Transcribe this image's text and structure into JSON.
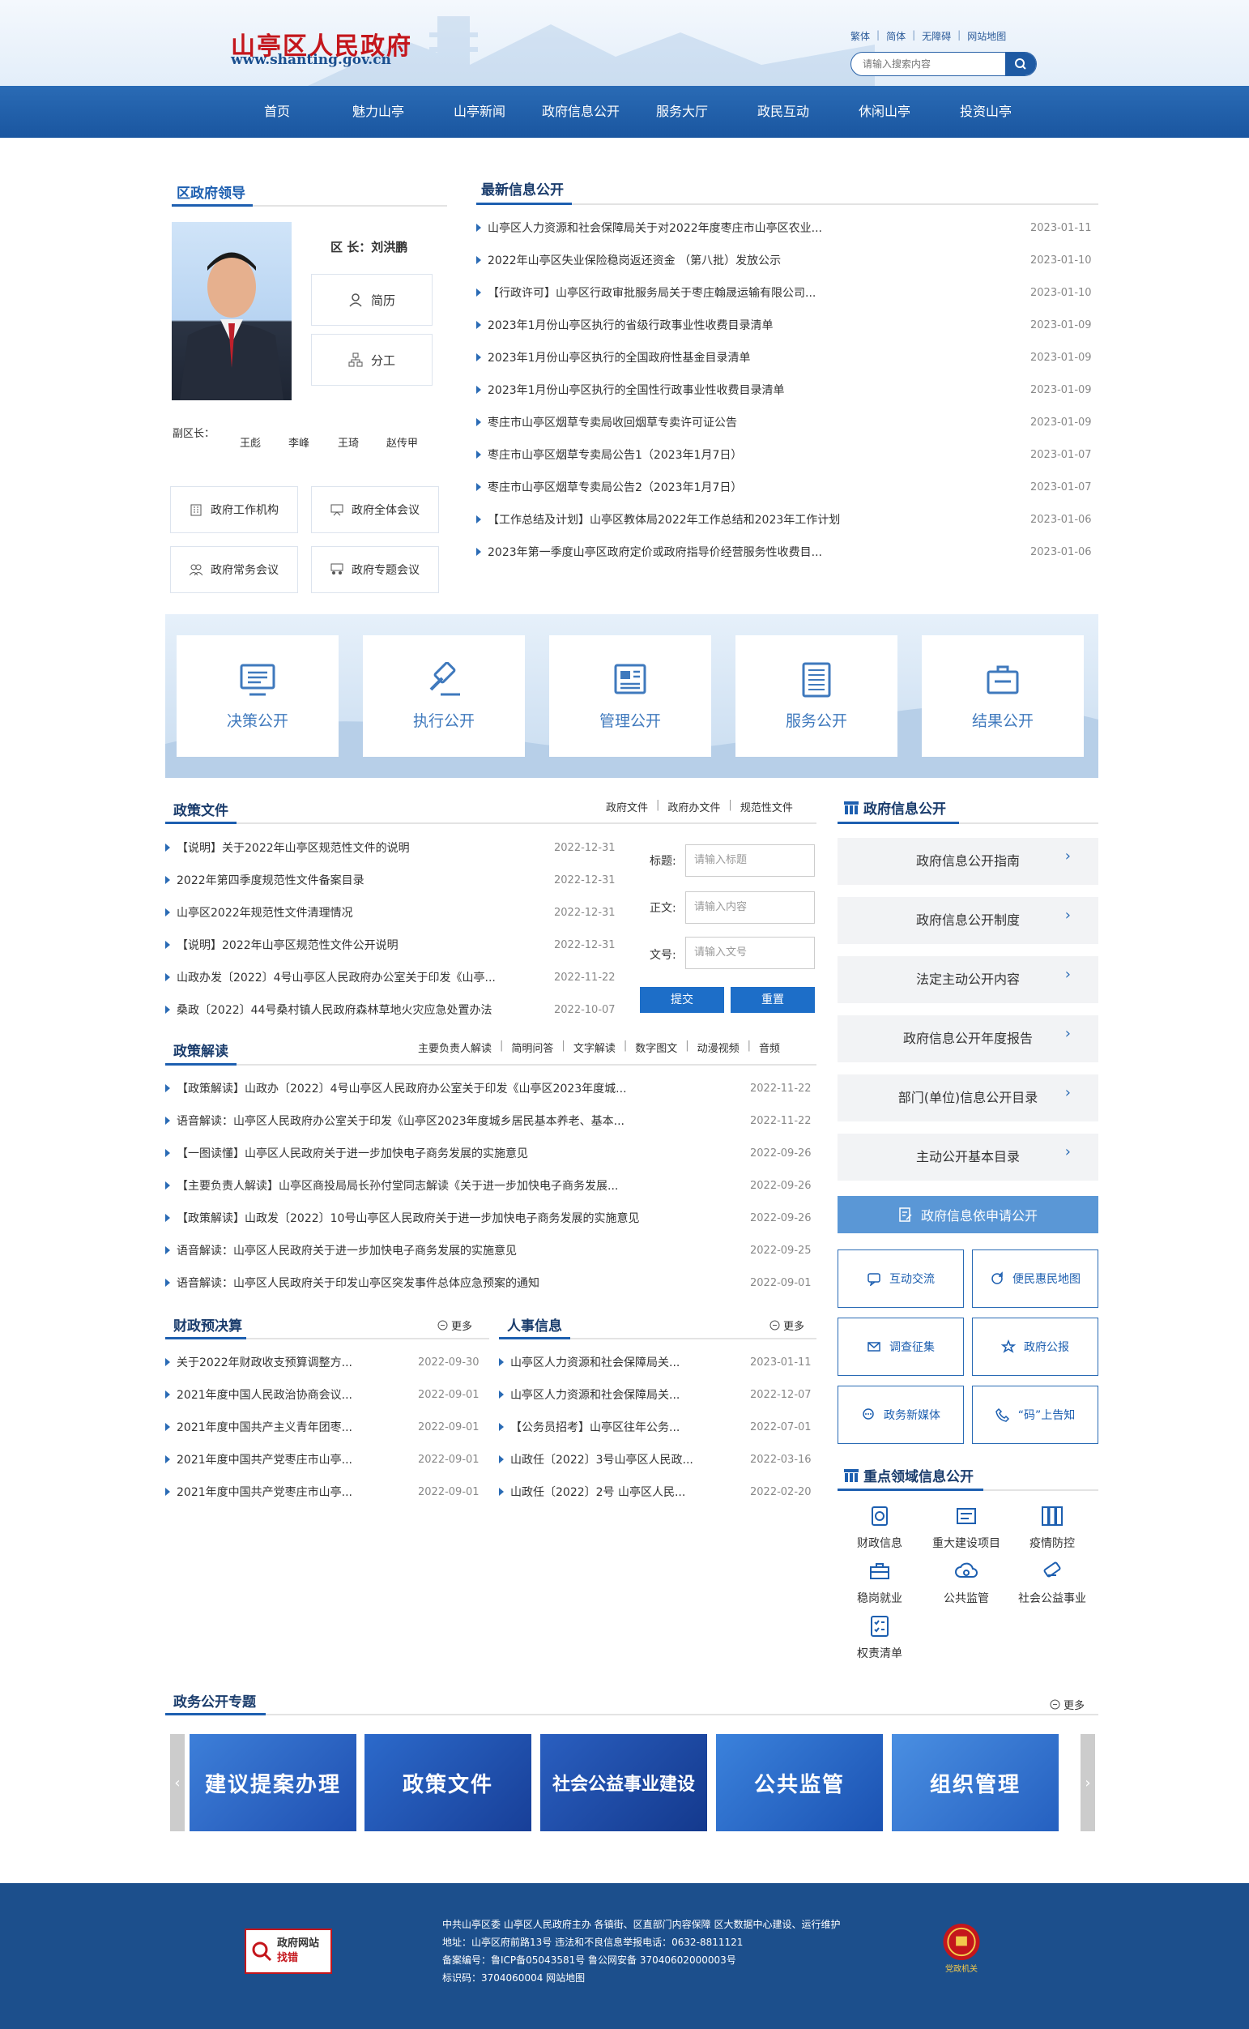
{
  "header": {
    "logo_cn": "山亭区人民政府",
    "logo_en": "www.shanting.gov.cn",
    "links": [
      "繁体",
      "简体",
      "无障碍",
      "网站地图"
    ],
    "search_placeholder": "请输入搜索内容"
  },
  "nav": [
    "首页",
    "魅力山亭",
    "山亭新闻",
    "政府信息公开",
    "服务大厅",
    "政民互动",
    "休闲山亭",
    "投资山亭"
  ],
  "leaders": {
    "title": "区政府领导",
    "head": "区 长：刘洪鹏",
    "resume": "简历",
    "division": "分工",
    "deputy_label": "副区长：",
    "deputies": [
      "王彪",
      "李峰",
      "王琦",
      "赵传甲"
    ],
    "buttons": [
      "政府工作机构",
      "政府全体会议",
      "政府常务会议",
      "政府专题会议"
    ]
  },
  "latest": {
    "title": "最新信息公开",
    "items": [
      {
        "t": "山亭区人力资源和社会保障局关于对2022年度枣庄市山亭区农业...",
        "d": "2023-01-11"
      },
      {
        "t": "2022年山亭区失业保险稳岗返还资金 （第八批）发放公示",
        "d": "2023-01-10"
      },
      {
        "t": "【行政许可】山亭区行政审批服务局关于枣庄翰晟运输有限公司...",
        "d": "2023-01-10"
      },
      {
        "t": "2023年1月份山亭区执行的省级行政事业性收费目录清单",
        "d": "2023-01-09"
      },
      {
        "t": "2023年1月份山亭区执行的全国政府性基金目录清单",
        "d": "2023-01-09"
      },
      {
        "t": "2023年1月份山亭区执行的全国性行政事业性收费目录清单",
        "d": "2023-01-09"
      },
      {
        "t": "枣庄市山亭区烟草专卖局收回烟草专卖许可证公告",
        "d": "2023-01-09"
      },
      {
        "t": "枣庄市山亭区烟草专卖局公告1（2023年1月7日）",
        "d": "2023-01-07"
      },
      {
        "t": "枣庄市山亭区烟草专卖局公告2（2023年1月7日）",
        "d": "2023-01-07"
      },
      {
        "t": "【工作总结及计划】山亭区教体局2022年工作总结和2023年工作计划",
        "d": "2023-01-06"
      },
      {
        "t": "2023年第一季度山亭区政府定价或政府指导价经营服务性收费目...",
        "d": "2023-01-06"
      }
    ]
  },
  "banner": [
    "决策公开",
    "执行公开",
    "管理公开",
    "服务公开",
    "结果公开"
  ],
  "policy": {
    "title": "政策文件",
    "tabs": [
      "政府文件",
      "政府办文件",
      "规范性文件"
    ],
    "items": [
      {
        "t": "【说明】关于2022年山亭区规范性文件的说明",
        "d": "2022-12-31"
      },
      {
        "t": "2022年第四季度规范性文件备案目录",
        "d": "2022-12-31"
      },
      {
        "t": "山亭区2022年规范性文件清理情况",
        "d": "2022-12-31"
      },
      {
        "t": "【说明】2022年山亭区规范性文件公开说明",
        "d": "2022-12-31"
      },
      {
        "t": "山政办发〔2022〕4号山亭区人民政府办公室关于印发《山亭...",
        "d": "2022-11-22"
      },
      {
        "t": "桑政〔2022〕44号桑村镇人民政府森林草地火灾应急处置办法",
        "d": "2022-10-07"
      }
    ],
    "form": {
      "title_label": "标题:",
      "title_ph": "请输入标题",
      "content_label": "正文:",
      "content_ph": "请输入内容",
      "doc_label": "文号:",
      "doc_ph": "请输入文号",
      "submit": "提交",
      "reset": "重置"
    }
  },
  "interpret": {
    "title": "政策解读",
    "tabs": [
      "主要负责人解读",
      "简明问答",
      "文字解读",
      "数字图文",
      "动漫视频",
      "音频"
    ],
    "items": [
      {
        "t": "【政策解读】山政办〔2022〕4号山亭区人民政府办公室关于印发《山亭区2023年度城...",
        "d": "2022-11-22"
      },
      {
        "t": "语音解读：山亭区人民政府办公室关于印发《山亭区2023年度城乡居民基本养老、基本...",
        "d": "2022-11-22"
      },
      {
        "t": "【一图读懂】山亭区人民政府关于进一步加快电子商务发展的实施意见",
        "d": "2022-09-26"
      },
      {
        "t": "【主要负责人解读】山亭区商投局局长孙付堂同志解读《关于进一步加快电子商务发展...",
        "d": "2022-09-26"
      },
      {
        "t": "【政策解读】山政发〔2022〕10号山亭区人民政府关于进一步加快电子商务发展的实施意见",
        "d": "2022-09-26"
      },
      {
        "t": "语音解读：山亭区人民政府关于进一步加快电子商务发展的实施意见",
        "d": "2022-09-25"
      },
      {
        "t": "语音解读：山亭区人民政府关于印发山亭区突发事件总体应急预案的通知",
        "d": "2022-09-01"
      }
    ]
  },
  "finance": {
    "title": "财政预决算",
    "more": "更多",
    "items": [
      {
        "t": "关于2022年财政收支预算调整方...",
        "d": "2022-09-30"
      },
      {
        "t": "2021年度中国人民政治协商会议...",
        "d": "2022-09-01"
      },
      {
        "t": "2021年度中国共产主义青年团枣...",
        "d": "2022-09-01"
      },
      {
        "t": "2021年度中国共产党枣庄市山亭...",
        "d": "2022-09-01"
      },
      {
        "t": "2021年度中国共产党枣庄市山亭...",
        "d": "2022-09-01"
      }
    ]
  },
  "personnel": {
    "title": "人事信息",
    "more": "更多",
    "items": [
      {
        "t": "山亭区人力资源和社会保障局关...",
        "d": "2023-01-11"
      },
      {
        "t": "山亭区人力资源和社会保障局关...",
        "d": "2022-12-07"
      },
      {
        "t": "【公务员招考】山亭区往年公务...",
        "d": "2022-07-01"
      },
      {
        "t": "山政任〔2022〕3号山亭区人民政...",
        "d": "2022-03-16"
      },
      {
        "t": "山政任〔2022〕2号 山亭区人民...",
        "d": "2022-02-20"
      }
    ]
  },
  "gov_info": {
    "title": "政府信息公开",
    "items": [
      "政府信息公开指南",
      "政府信息公开制度",
      "法定主动公开内容",
      "政府信息公开年度报告",
      "部门(单位)信息公开目录",
      "主动公开基本目录"
    ],
    "apply": "政府信息依申请公开",
    "grid": [
      "互动交流",
      "便民惠民地图",
      "调查征集",
      "政府公报",
      "政务新媒体",
      "“码”上告知"
    ]
  },
  "key_areas": {
    "title": "重点领域信息公开",
    "items": [
      "财政信息",
      "重大建设项目",
      "疫情防控",
      "稳岗就业",
      "公共监管",
      "社会公益事业",
      "权责清单"
    ]
  },
  "topics": {
    "title": "政务公开专题",
    "more": "更多",
    "slides": [
      "建议提案办理",
      "政策文件",
      "社会公益事业建设",
      "公共监管",
      "组织管理"
    ]
  },
  "footer": {
    "badge_line1": "政府网站",
    "badge_line2": "找错",
    "lines": [
      "中共山亭区委 山亭区人民政府主办 各镇街、区直部门内容保障 区大数据中心建设、运行维护",
      "地址：山亭区府前路13号 违法和不良信息举报电话：0632-8811121",
      "备案编号：鲁ICP备05043581号    鲁公网安备 37040602000003号",
      "标识码：3704060004    网站地图"
    ],
    "party_badge": "党政机关"
  },
  "colors": {
    "primary": "#1d5fb0",
    "nav": "#1f5ea8",
    "footer": "#1c4f8c",
    "logo_red": "#c4161c"
  }
}
